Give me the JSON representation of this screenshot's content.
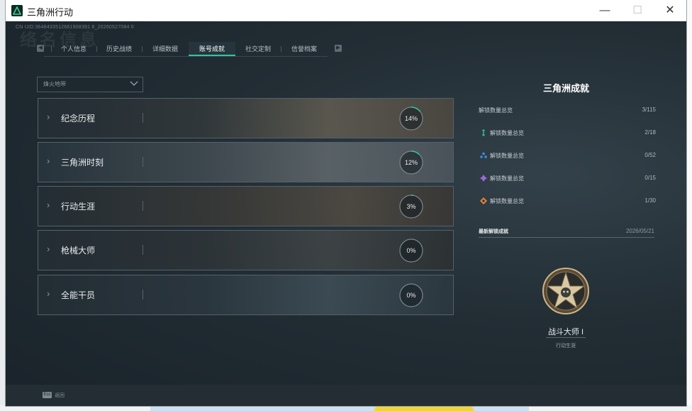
{
  "window": {
    "title": "三角洲行动",
    "controls": {
      "minimize": "—",
      "maximize": "☐",
      "close": "✕"
    }
  },
  "header": {
    "uid": "CN UID:3648433512661908391 8_20260527084 0",
    "big_title": "络名信息"
  },
  "tabs": [
    "个人信息",
    "历史战绩",
    "详细数据",
    "账号成就",
    "社交定制",
    "信誉档案"
  ],
  "active_tab": 3,
  "filter": {
    "value": "烽火地带"
  },
  "categories": [
    {
      "label": "纪念历程",
      "percent_text": "14%",
      "progress": 0.14
    },
    {
      "label": "三角洲时刻",
      "percent_text": "12%",
      "progress": 0.12
    },
    {
      "label": "行动生涯",
      "percent_text": "3%",
      "progress": 0.03
    },
    {
      "label": "枪械大师",
      "percent_text": "0%",
      "progress": 0.0
    },
    {
      "label": "全能干员",
      "percent_text": "0%",
      "progress": 0.0
    }
  ],
  "side": {
    "title": "三角洲成就",
    "total": {
      "label": "解锁数量总览",
      "value": "3/115"
    },
    "tiers": [
      {
        "label": "解锁数量总览",
        "value": "2/18",
        "icon": "green-tier-icon",
        "color": "#2fbf8f"
      },
      {
        "label": "解锁数量总览",
        "value": "0/52",
        "icon": "blue-tier-icon",
        "color": "#3d8fe0"
      },
      {
        "label": "解锁数量总览",
        "value": "0/15",
        "icon": "purple-tier-icon",
        "color": "#9a6ad8"
      },
      {
        "label": "解锁数量总览",
        "value": "1/30",
        "icon": "orange-tier-icon",
        "color": "#e0813a"
      }
    ],
    "recent": {
      "label": "最新解锁成就",
      "date": "2026/05/21"
    },
    "badge": {
      "name": "战斗大师 I",
      "category": "行动生涯"
    }
  },
  "footer": {
    "esc_key": "Esc",
    "esc_label": "返回"
  },
  "colors": {
    "accent": "#34c49a"
  }
}
